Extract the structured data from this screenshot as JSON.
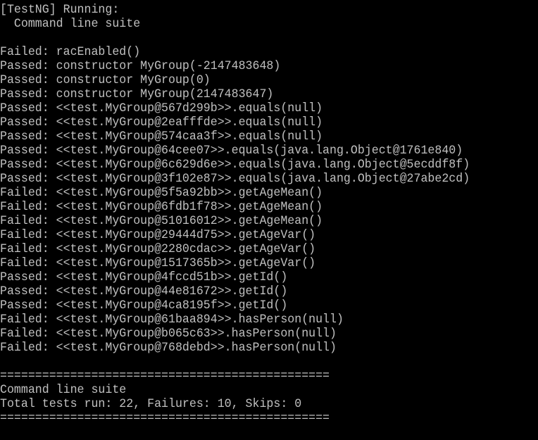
{
  "console": {
    "background": "#000000",
    "text_color": "#c0c0c0",
    "header": [
      "[TestNG] Running:",
      "  Command line suite",
      ""
    ],
    "results": [
      "Failed: racEnabled()",
      "Passed: constructor MyGroup(-2147483648)",
      "Passed: constructor MyGroup(0)",
      "Passed: constructor MyGroup(2147483647)",
      "Passed: <<test.MyGroup@567d299b>>.equals(null)",
      "Passed: <<test.MyGroup@2eafffde>>.equals(null)",
      "Passed: <<test.MyGroup@574caa3f>>.equals(null)",
      "Passed: <<test.MyGroup@64cee07>>.equals(java.lang.Object@1761e840)",
      "Passed: <<test.MyGroup@6c629d6e>>.equals(java.lang.Object@5ecddf8f)",
      "Passed: <<test.MyGroup@3f102e87>>.equals(java.lang.Object@27abe2cd)",
      "Failed: <<test.MyGroup@5f5a92bb>>.getAgeMean()",
      "Failed: <<test.MyGroup@6fdb1f78>>.getAgeMean()",
      "Failed: <<test.MyGroup@51016012>>.getAgeMean()",
      "Failed: <<test.MyGroup@29444d75>>.getAgeVar()",
      "Failed: <<test.MyGroup@2280cdac>>.getAgeVar()",
      "Failed: <<test.MyGroup@1517365b>>.getAgeVar()",
      "Passed: <<test.MyGroup@4fccd51b>>.getId()",
      "Passed: <<test.MyGroup@44e81672>>.getId()",
      "Passed: <<test.MyGroup@4ca8195f>>.getId()",
      "Failed: <<test.MyGroup@61baa894>>.hasPerson(null)",
      "Failed: <<test.MyGroup@b065c63>>.hasPerson(null)",
      "Failed: <<test.MyGroup@768debd>>.hasPerson(null)"
    ],
    "separator": "===============================================",
    "suite_name": "Command line suite",
    "summary": "Total tests run: 22, Failures: 10, Skips: 0"
  }
}
